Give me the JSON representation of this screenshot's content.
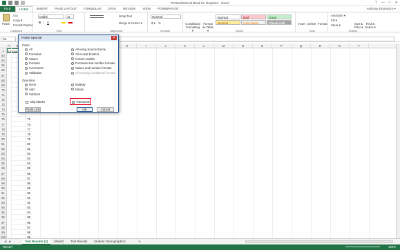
{
  "window": {
    "title": "PCWorld Excel Book for Graphics - Excel",
    "controls": [
      "?",
      "—",
      "□",
      "✕"
    ],
    "user": "Anthony Domanico ▾"
  },
  "ribbon_tabs": [
    "FILE",
    "HOME",
    "INSERT",
    "PAGE LAYOUT",
    "FORMULAS",
    "DATA",
    "REVIEW",
    "VIEW",
    "POWERPIVOT"
  ],
  "active_tab": "HOME",
  "ribbon": {
    "clipboard": {
      "label": "Clipboard",
      "paste": "Paste",
      "cut": "Cut",
      "copy": "Copy ▾",
      "painter": "Format Painter"
    },
    "font": {
      "label": "Font",
      "name": "Calibri",
      "size": "11",
      "bold": "B",
      "italic": "I",
      "underline": "U"
    },
    "alignment": {
      "label": "Alignment",
      "wrap": "Wrap Text",
      "merge": "Merge & Center ▾"
    },
    "number": {
      "label": "Number",
      "format": "General",
      "currency": "$ ▾",
      "percent": "%",
      "comma": ","
    },
    "styles": {
      "label": "Styles",
      "conditional": "Conditional Formatting ▾",
      "format_table": "Format as Table ▾",
      "cells": [
        {
          "name": "Normal",
          "bg": "#ffffff",
          "fg": "#000000"
        },
        {
          "name": "Bad",
          "bg": "#ffc7ce",
          "fg": "#9c0006"
        },
        {
          "name": "Good",
          "bg": "#c6efce",
          "fg": "#006100"
        },
        {
          "name": "Neutral",
          "bg": "#ffeb9c",
          "fg": "#9c5700"
        },
        {
          "name": "Calculation",
          "bg": "#f2f2f2",
          "fg": "#fa7d00"
        },
        {
          "name": "Check Cell",
          "bg": "#a5a5a5",
          "fg": "#ffffff"
        }
      ]
    },
    "cells": {
      "label": "Cells",
      "insert": "Insert",
      "delete": "Delete",
      "format": "Format"
    },
    "editing": {
      "label": "Editing",
      "autosum": "AutoSum ▾",
      "fill": "Fill ▾",
      "clear": "Clear ▾",
      "sort": "Sort & Filter ▾",
      "find": "Find & Select ▾"
    }
  },
  "formula_bar": {
    "name_box": "C1",
    "fx": "fx",
    "value": ""
  },
  "columns": [
    "A",
    "B",
    "C",
    "D",
    "E",
    "F",
    "G",
    "H",
    "I",
    "J",
    "K",
    "L",
    "M",
    "N",
    "O",
    "P",
    "Q",
    "R",
    "S",
    "T"
  ],
  "rows": {
    "numbers": [
      "1",
      "63",
      "64",
      "65",
      "66",
      "67",
      "68",
      "69",
      "70",
      "71",
      "72",
      "73",
      "74",
      "75",
      "76",
      "77",
      "78",
      "79",
      "80",
      "81",
      "82",
      "83",
      "84",
      "85",
      "86",
      "87",
      "88",
      "89",
      "90",
      "91",
      "92",
      "93",
      "94",
      "95",
      "96",
      "97",
      "98",
      "99",
      "100"
    ],
    "values": [
      "Unique ID",
      "",
      "",
      "",
      "",
      "",
      "",
      "",
      "",
      "",
      "",
      "",
      "",
      "",
      "75",
      "76",
      "77",
      "78",
      "79",
      "80",
      "81",
      "82",
      "83",
      "84",
      "85",
      "86",
      "87",
      "88",
      "89",
      "90",
      "91",
      "92",
      "93",
      "94",
      "95",
      "96",
      "97",
      "98",
      "99"
    ]
  },
  "sheet_tabs": [
    "Test Results (2)",
    "Sheet2",
    "Test Results",
    "Student Demographics"
  ],
  "active_sheet": "Test Results (2)",
  "status": {
    "left": "READY",
    "zoom": "100%"
  },
  "dialog": {
    "title": "Paste Special",
    "close": "✕",
    "paste_label": "Paste",
    "paste_left": [
      "All",
      "Formulas",
      "Values",
      "Formats",
      "Comments",
      "Validation"
    ],
    "paste_right": [
      "All using Source theme",
      "All except borders",
      "Column widths",
      "Formulas and number formats",
      "Values and number formats",
      "All merging conditional formats"
    ],
    "paste_selected": "Values",
    "operation_label": "Operation",
    "op_left": [
      "None",
      "Add",
      "Subtract"
    ],
    "op_right": [
      "Multiply",
      "Divide"
    ],
    "op_selected": "None",
    "skip_blanks": "Skip blanks",
    "transpose": "Transpose",
    "transpose_checked": true,
    "paste_link": "Paste Link",
    "ok": "OK",
    "cancel": "Cancel"
  }
}
